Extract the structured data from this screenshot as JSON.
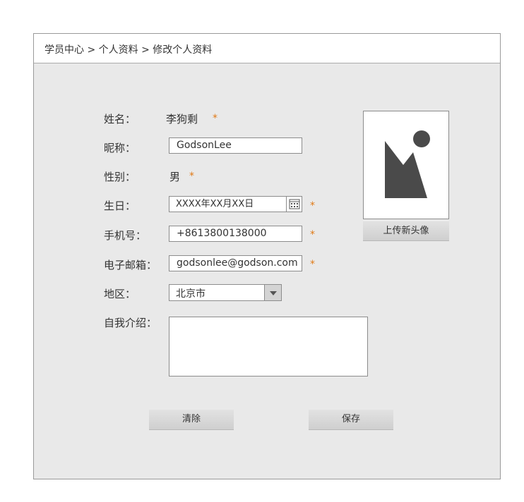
{
  "breadcrumb": "学员中心 > 个人资料 > 修改个人资料",
  "form": {
    "name_label": "姓名：",
    "name_value": "李狗剩",
    "nickname_label": "昵称：",
    "nickname_value": "GodsonLee",
    "gender_label": "性别：",
    "gender_value": "男",
    "birthday_label": "生日：",
    "birthday_value": "XXXX年XX月XX日",
    "phone_label": "手机号：",
    "phone_value": "+8613800138000",
    "email_label": "电子邮箱：",
    "email_value": "godsonlee@godson.com",
    "region_label": "地区：",
    "region_value": "北京市",
    "intro_label": "自我介绍：",
    "intro_value": "",
    "required_mark": "*"
  },
  "avatar": {
    "upload_label": "上传新头像"
  },
  "buttons": {
    "clear_label": "清除",
    "save_label": "保存"
  },
  "colors": {
    "required": "#e07a16",
    "panel_bg": "#e9e9e9",
    "border": "#8c8c8c"
  }
}
